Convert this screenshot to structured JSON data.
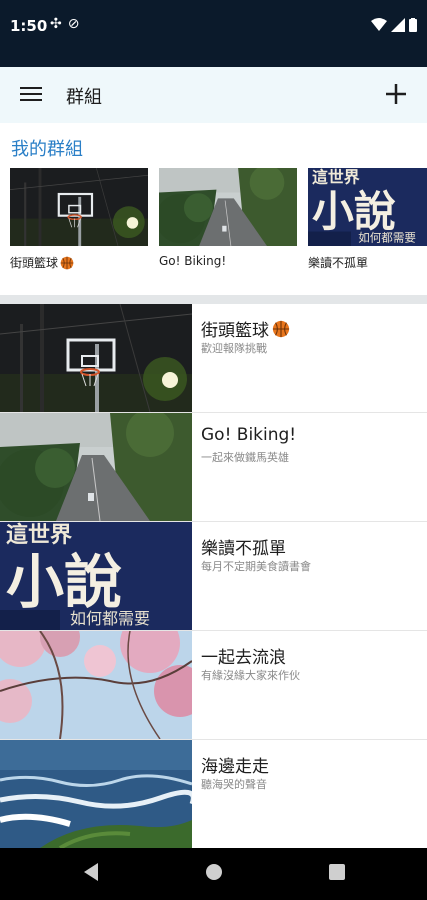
{
  "status_bar": {
    "time": "1:50"
  },
  "app_bar": {
    "title": "群組"
  },
  "my_groups": {
    "title": "我的群組",
    "cards": [
      {
        "label": "街頭籃球",
        "image": "basketball-court"
      },
      {
        "label": "Go! Biking!",
        "image": "bike-road"
      },
      {
        "label": "樂讀不孤單",
        "image": "novel-poster"
      }
    ]
  },
  "groups": [
    {
      "title": "街頭籃球",
      "subtitle": "歡迎報隊挑戰",
      "image": "basketball-court",
      "badge": "basketball-icon"
    },
    {
      "title": "Go! Biking!",
      "subtitle": "一起來做鐵馬英雄",
      "image": "bike-road"
    },
    {
      "title": "樂讀不孤單",
      "subtitle": "每月不定期美食讀書會",
      "image": "novel-poster"
    },
    {
      "title": "一起去流浪",
      "subtitle": "有緣沒緣大家來作伙",
      "image": "cherry-blossom"
    },
    {
      "title": "海邊走走",
      "subtitle": "聽海哭的聲音",
      "image": "ocean-waves"
    }
  ],
  "colors": {
    "status_bar": "#0b1a2b",
    "app_bar": "#eff8fb",
    "accent": "#2a7fc7",
    "nav_bar": "#000000"
  }
}
